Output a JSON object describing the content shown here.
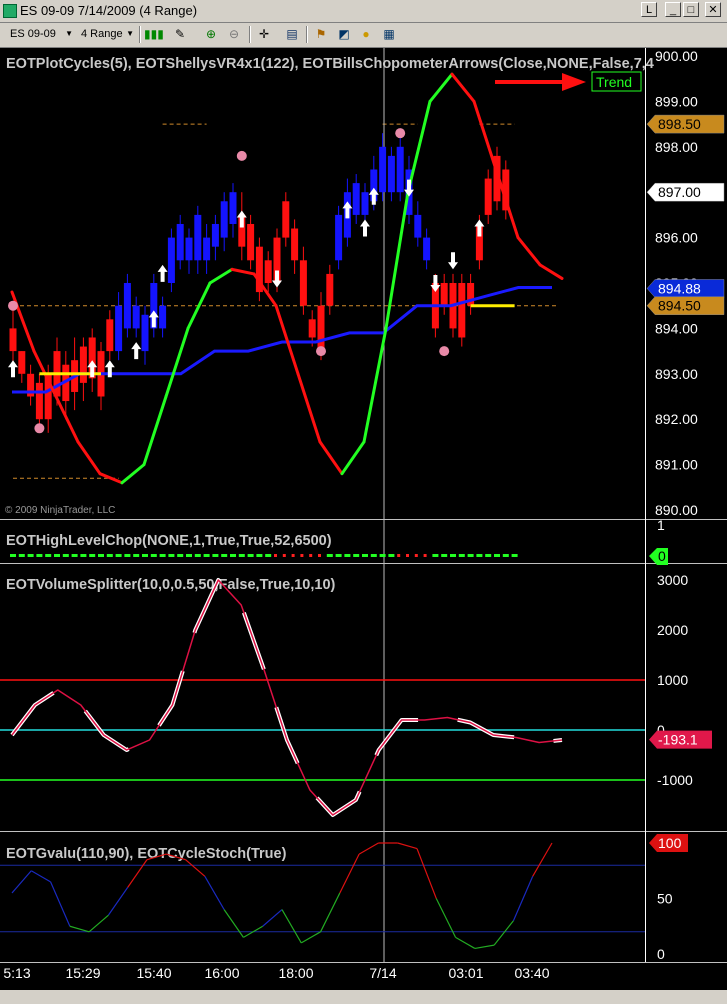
{
  "window": {
    "title": "ES 09-09  7/14/2009 (4 Range)",
    "buttons": {
      "link": "L",
      "minimize": "_",
      "maximize": "□",
      "close": "✕"
    }
  },
  "toolbar": {
    "instrument": "ES 09-09",
    "period": "4 Range",
    "icons": [
      "candlestick-style-icon",
      "draw-pencil-icon",
      "zoom-in-icon",
      "zoom-out-icon",
      "crosshair-icon",
      "properties-icon",
      "strategies-icon",
      "indicators-icon",
      "data-box-icon",
      "chart-trader-icon"
    ]
  },
  "panels": {
    "price": {
      "indicator_title": "EOTPlotCycles(5),  EOTShellysVR4x1(122),  EOTBillsChopometerArrows(Close,NONE,False,7,4",
      "trend_label": "Trend",
      "copyright": "© 2009 NinjaTrader, LLC",
      "y_ticks": [
        "900.00",
        "899.00",
        "898.00",
        "897.00",
        "896.00",
        "895.00",
        "894.00",
        "893.00",
        "892.00",
        "891.00",
        "890.00"
      ],
      "badges": [
        {
          "text": "898.50",
          "value": 898.5,
          "bg": "#c88a1e",
          "fg": "#000000"
        },
        {
          "text": "897.00",
          "value": 897.0,
          "bg": "#ffffff",
          "fg": "#000000"
        },
        {
          "text": "894.88",
          "value": 894.88,
          "bg": "#0a2ad8",
          "fg": "#ffffff"
        },
        {
          "text": "894.50",
          "value": 894.5,
          "bg": "#c88a1e",
          "fg": "#000000"
        }
      ]
    },
    "chop": {
      "indicator_title": "EOTHighLevelChop(NONE,1,True,True,52,6500)",
      "y_ticks": [
        "1"
      ],
      "badge": "0"
    },
    "volume": {
      "indicator_title": "EOTVolumeSplitter(10,0,0.5,50,False,True,10,10)",
      "y_ticks": [
        "3000",
        "2000",
        "1000",
        "0",
        "-1000"
      ],
      "badge": "-193.1"
    },
    "gvalu": {
      "indicator_title": "EOTGvalu(110,90), EOTCycleStoch(True)",
      "y_ticks": [
        "50",
        "0"
      ],
      "badge": "100"
    }
  },
  "x_axis": {
    "labels": [
      "5:13",
      "15:29",
      "15:40",
      "16:00",
      "18:00",
      "7/14",
      "03:01",
      "03:40"
    ]
  },
  "chart_data": {
    "type": "candlestick",
    "price_axis_range": [
      890.0,
      900.0
    ],
    "last_price": 897.0,
    "bars": [
      {
        "o": 894.0,
        "c": 893.5,
        "h": 894.5,
        "l": 893.0,
        "color": "red"
      },
      {
        "o": 893.5,
        "c": 893.0,
        "h": 893.5,
        "l": 892.8,
        "color": "red"
      },
      {
        "o": 892.5,
        "c": 893.0,
        "h": 893.2,
        "l": 892.3,
        "color": "red"
      },
      {
        "o": 892.8,
        "c": 892.0,
        "h": 893.0,
        "l": 891.8,
        "color": "red"
      },
      {
        "o": 893.0,
        "c": 892.0,
        "h": 893.2,
        "l": 891.7,
        "color": "red"
      },
      {
        "o": 893.5,
        "c": 892.5,
        "h": 893.8,
        "l": 892.3,
        "color": "red"
      },
      {
        "o": 893.2,
        "c": 892.4,
        "h": 893.5,
        "l": 892.0,
        "color": "red"
      },
      {
        "o": 893.3,
        "c": 892.6,
        "h": 893.8,
        "l": 892.2,
        "color": "red"
      },
      {
        "o": 893.6,
        "c": 892.8,
        "h": 893.8,
        "l": 892.4,
        "color": "red"
      },
      {
        "o": 893.8,
        "c": 892.9,
        "h": 894.0,
        "l": 892.6,
        "color": "red"
      },
      {
        "o": 893.5,
        "c": 892.5,
        "h": 893.7,
        "l": 892.2,
        "color": "red"
      },
      {
        "o": 894.2,
        "c": 893.5,
        "h": 894.4,
        "l": 893.3,
        "color": "red"
      },
      {
        "o": 893.5,
        "c": 894.5,
        "h": 894.8,
        "l": 893.3,
        "color": "blue"
      },
      {
        "o": 894.0,
        "c": 895.0,
        "h": 895.2,
        "l": 893.8,
        "color": "blue"
      },
      {
        "o": 894.5,
        "c": 894.0,
        "h": 894.7,
        "l": 893.8,
        "color": "blue"
      },
      {
        "o": 893.5,
        "c": 894.3,
        "h": 894.5,
        "l": 893.2,
        "color": "blue"
      },
      {
        "o": 894.0,
        "c": 895.0,
        "h": 895.2,
        "l": 893.8,
        "color": "blue"
      },
      {
        "o": 894.5,
        "c": 894.0,
        "h": 894.7,
        "l": 893.8,
        "color": "blue"
      },
      {
        "o": 895.0,
        "c": 896.0,
        "h": 896.2,
        "l": 894.8,
        "color": "blue"
      },
      {
        "o": 895.5,
        "c": 896.3,
        "h": 896.5,
        "l": 895.3,
        "color": "blue"
      },
      {
        "o": 896.0,
        "c": 895.5,
        "h": 896.2,
        "l": 895.2,
        "color": "blue"
      },
      {
        "o": 895.5,
        "c": 896.5,
        "h": 896.7,
        "l": 895.2,
        "color": "blue"
      },
      {
        "o": 895.5,
        "c": 896.0,
        "h": 896.3,
        "l": 895.2,
        "color": "blue"
      },
      {
        "o": 895.8,
        "c": 896.3,
        "h": 896.5,
        "l": 895.5,
        "color": "blue"
      },
      {
        "o": 896.0,
        "c": 896.8,
        "h": 897.0,
        "l": 895.7,
        "color": "blue"
      },
      {
        "o": 896.3,
        "c": 897.0,
        "h": 897.2,
        "l": 896.0,
        "color": "blue"
      },
      {
        "o": 896.5,
        "c": 895.8,
        "h": 897.0,
        "l": 895.5,
        "color": "red"
      },
      {
        "o": 896.3,
        "c": 895.5,
        "h": 896.5,
        "l": 895.3,
        "color": "red"
      },
      {
        "o": 895.8,
        "c": 894.8,
        "h": 896.0,
        "l": 894.6,
        "color": "red"
      },
      {
        "o": 895.5,
        "c": 895.0,
        "h": 895.7,
        "l": 894.8,
        "color": "red"
      },
      {
        "o": 896.0,
        "c": 895.0,
        "h": 896.2,
        "l": 894.8,
        "color": "red"
      },
      {
        "o": 896.8,
        "c": 896.0,
        "h": 897.0,
        "l": 895.8,
        "color": "red"
      },
      {
        "o": 896.2,
        "c": 895.5,
        "h": 896.4,
        "l": 895.2,
        "color": "red"
      },
      {
        "o": 895.5,
        "c": 894.5,
        "h": 895.8,
        "l": 894.3,
        "color": "red"
      },
      {
        "o": 894.2,
        "c": 893.8,
        "h": 894.4,
        "l": 893.6,
        "color": "red"
      },
      {
        "o": 894.5,
        "c": 893.5,
        "h": 894.8,
        "l": 893.3,
        "color": "red"
      },
      {
        "o": 895.2,
        "c": 894.5,
        "h": 895.4,
        "l": 894.3,
        "color": "red"
      },
      {
        "o": 895.5,
        "c": 896.5,
        "h": 896.7,
        "l": 895.3,
        "color": "blue"
      },
      {
        "o": 896.0,
        "c": 897.0,
        "h": 897.3,
        "l": 895.8,
        "color": "blue"
      },
      {
        "o": 896.5,
        "c": 897.2,
        "h": 897.4,
        "l": 896.3,
        "color": "blue"
      },
      {
        "o": 896.5,
        "c": 897.0,
        "h": 897.2,
        "l": 896.3,
        "color": "blue"
      },
      {
        "o": 896.8,
        "c": 897.5,
        "h": 897.8,
        "l": 896.6,
        "color": "blue"
      },
      {
        "o": 897.0,
        "c": 898.0,
        "h": 898.3,
        "l": 896.8,
        "color": "blue"
      },
      {
        "o": 897.0,
        "c": 897.8,
        "h": 898.0,
        "l": 896.8,
        "color": "blue"
      },
      {
        "o": 897.0,
        "c": 898.0,
        "h": 898.2,
        "l": 896.8,
        "color": "blue"
      },
      {
        "o": 896.5,
        "c": 897.5,
        "h": 897.8,
        "l": 896.3,
        "color": "blue"
      },
      {
        "o": 896.0,
        "c": 896.5,
        "h": 896.8,
        "l": 895.8,
        "color": "blue"
      },
      {
        "o": 895.5,
        "c": 896.0,
        "h": 896.2,
        "l": 895.3,
        "color": "blue"
      },
      {
        "o": 895.0,
        "c": 894.0,
        "h": 895.2,
        "l": 893.8,
        "color": "red"
      },
      {
        "o": 895.0,
        "c": 894.5,
        "h": 895.2,
        "l": 894.3,
        "color": "red"
      },
      {
        "o": 895.0,
        "c": 894.0,
        "h": 895.2,
        "l": 893.8,
        "color": "red"
      },
      {
        "o": 895.0,
        "c": 893.8,
        "h": 895.2,
        "l": 893.6,
        "color": "red"
      },
      {
        "o": 895.0,
        "c": 894.5,
        "h": 895.2,
        "l": 894.3,
        "color": "red"
      },
      {
        "o": 896.3,
        "c": 895.5,
        "h": 896.5,
        "l": 895.3,
        "color": "red"
      },
      {
        "o": 897.3,
        "c": 896.5,
        "h": 897.5,
        "l": 896.3,
        "color": "red"
      },
      {
        "o": 897.8,
        "c": 896.8,
        "h": 898.0,
        "l": 896.6,
        "color": "red"
      },
      {
        "o": 897.5,
        "c": 896.6,
        "h": 897.7,
        "l": 896.4,
        "color": "red"
      }
    ],
    "arrows": [
      {
        "bar": 0,
        "dir": "up",
        "value": 893.1
      },
      {
        "bar": 9,
        "dir": "up",
        "value": 893.1
      },
      {
        "bar": 11,
        "dir": "up",
        "value": 893.1
      },
      {
        "bar": 14,
        "dir": "up",
        "value": 893.5
      },
      {
        "bar": 16,
        "dir": "up",
        "value": 894.2
      },
      {
        "bar": 17,
        "dir": "up",
        "value": 895.2
      },
      {
        "bar": 26,
        "dir": "up",
        "value": 896.4
      },
      {
        "bar": 30,
        "dir": "down",
        "value": 895.1
      },
      {
        "bar": 38,
        "dir": "up",
        "value": 896.6
      },
      {
        "bar": 40,
        "dir": "up",
        "value": 896.2
      },
      {
        "bar": 41,
        "dir": "up",
        "value": 896.9
      },
      {
        "bar": 45,
        "dir": "down",
        "value": 897.1
      },
      {
        "bar": 48,
        "dir": "down",
        "value": 895.0
      },
      {
        "bar": 50,
        "dir": "down",
        "value": 895.5
      },
      {
        "bar": 53,
        "dir": "up",
        "value": 896.2
      }
    ],
    "dots": [
      {
        "bar": 0,
        "value": 894.5
      },
      {
        "bar": 3,
        "value": 891.8
      },
      {
        "bar": 26,
        "value": 897.8
      },
      {
        "bar": 35,
        "value": 893.5
      },
      {
        "bar": 44,
        "value": 898.3
      },
      {
        "bar": 49,
        "value": 893.5
      }
    ],
    "dashed_levels": [
      898.5,
      894.5,
      890.7
    ],
    "overlays": {
      "cycle_red_green": [
        894.8,
        893.5,
        892.5,
        891.5,
        890.8,
        890.6,
        891.0,
        892.5,
        894.0,
        895.0,
        895.3,
        895.2,
        894.5,
        893.0,
        891.5,
        890.8,
        891.5,
        894.0,
        897.0,
        899.0,
        899.6,
        899.0,
        897.5,
        896.0,
        895.4,
        895.1
      ],
      "shelly_blue": [
        892.6,
        892.6,
        893.0,
        893.0,
        893.0,
        893.0,
        893.5,
        893.5,
        893.7,
        893.7,
        893.9,
        893.9,
        894.5,
        894.5,
        894.7,
        894.9,
        894.9
      ],
      "chop_green": [
        1,
        1,
        1,
        1,
        1,
        1,
        1,
        1,
        1,
        1,
        1,
        1,
        1,
        1,
        1,
        1,
        1,
        1,
        1,
        1,
        1,
        1,
        1,
        1,
        1,
        1,
        1,
        1,
        1,
        1,
        0,
        0,
        0,
        0,
        0,
        0,
        1,
        1,
        1,
        1,
        1,
        1,
        1,
        1,
        0,
        0,
        0,
        0,
        1,
        1,
        1,
        1,
        1,
        1,
        1,
        1,
        1,
        1
      ]
    },
    "volume_splitter": {
      "levels": [
        1000,
        0,
        -1000
      ],
      "last": -193.1,
      "values": [
        -100,
        500,
        800,
        500,
        -100,
        -400,
        -200,
        500,
        2000,
        3000,
        2500,
        1200,
        -200,
        -1200,
        -1700,
        -1400,
        -400,
        200,
        200,
        250,
        150,
        -100,
        -150,
        -250,
        -200
      ]
    },
    "gvalu": {
      "levels": [
        80,
        20
      ],
      "last": 100,
      "values": [
        55,
        75,
        65,
        25,
        20,
        35,
        60,
        85,
        90,
        85,
        70,
        40,
        15,
        25,
        40,
        10,
        20,
        55,
        90,
        100,
        100,
        95,
        50,
        15,
        5,
        8,
        30,
        70,
        100
      ]
    }
  }
}
